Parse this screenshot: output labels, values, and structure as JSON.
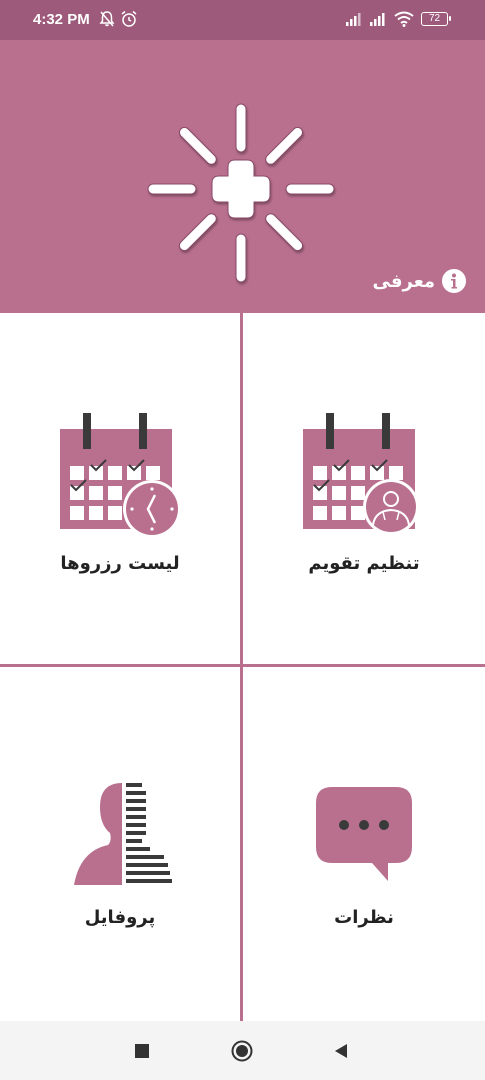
{
  "status_bar": {
    "time": "4:32 PM",
    "battery": "72",
    "icons": [
      "mute-bell-icon",
      "alarm-clock-icon",
      "signal-icon",
      "signal-icon",
      "wifi-icon",
      "battery-icon"
    ]
  },
  "header": {
    "logo_icon": "medical-plus-burst-icon",
    "intro_label": "معرفی",
    "intro_icon": "info-icon"
  },
  "tiles": [
    {
      "label": "تنظیم تقویم",
      "icon": "calendar-doctor-icon"
    },
    {
      "label": "لیست رزروها",
      "icon": "calendar-clock-icon"
    },
    {
      "label": "نظرات",
      "icon": "chat-bubble-icon"
    },
    {
      "label": "پروفایل",
      "icon": "profile-icon"
    }
  ],
  "nav": {
    "icons": [
      "recents-square-icon",
      "home-circle-icon",
      "back-triangle-icon"
    ]
  },
  "colors": {
    "primary": "#b9708f",
    "status_bar": "#9e5a7a",
    "dark": "#3a3a3a"
  }
}
